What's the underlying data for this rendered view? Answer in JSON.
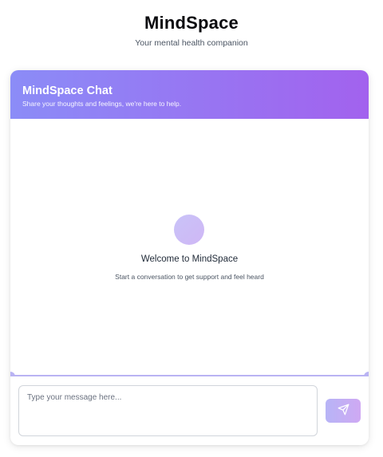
{
  "app": {
    "title": "MindSpace",
    "subtitle": "Your mental health companion"
  },
  "chat": {
    "title": "MindSpace Chat",
    "description": "Share your thoughts and feelings, we're here to help.",
    "welcome_title": "Welcome to MindSpace",
    "welcome_text": "Start a conversation to get support and feel heard",
    "input_placeholder": "Type your message here...",
    "input_value": "",
    "send_icon": "send-icon"
  },
  "colors": {
    "header_gradient_start": "#8b8cf7",
    "header_gradient_end": "#a262ee",
    "avatar": "#c9c3f8",
    "send_button": "#c2aff5"
  }
}
